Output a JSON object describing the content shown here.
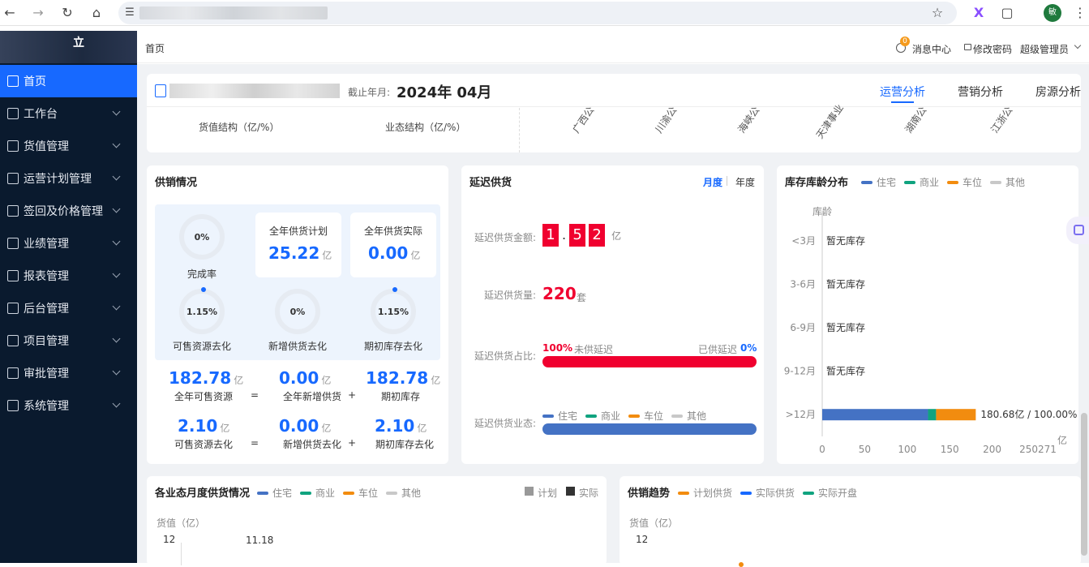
{
  "browser": {
    "profile_initial": "敏"
  },
  "sidebar": {
    "logo_char": "立",
    "items": [
      {
        "label": "首页",
        "active": true
      },
      {
        "label": "工作台"
      },
      {
        "label": "货值管理"
      },
      {
        "label": "运营计划管理"
      },
      {
        "label": "签回及价格管理"
      },
      {
        "label": "业绩管理"
      },
      {
        "label": "报表管理"
      },
      {
        "label": "后台管理"
      },
      {
        "label": "项目管理"
      },
      {
        "label": "审批管理"
      },
      {
        "label": "系统管理"
      }
    ]
  },
  "topbar": {
    "breadcrumb": "首页",
    "badge": "0",
    "messages": "消息中心",
    "change_password": "修改密码",
    "user": "超级管理员"
  },
  "header_card": {
    "deadline_label": "截止年月:",
    "deadline_value": "2024年 04月",
    "tabs": [
      "运营分析",
      "营销分析",
      "房源分析"
    ],
    "sub_labels": [
      "货值结构（亿/%）",
      "业态结构（亿/%）"
    ],
    "rotated_labels": [
      "广西公",
      "川渝公",
      "海峡公",
      "天津事业",
      "湖南公",
      "江浙公"
    ]
  },
  "supply": {
    "title": "供销情况",
    "rate_ring": "0%",
    "rate_label": "完成率",
    "plan_label": "全年供货计划",
    "plan_value": "25.22",
    "actual_label": "全年供货实际",
    "actual_value": "0.00",
    "unit": "亿",
    "rings": [
      {
        "value": "1.15%",
        "label": "可售资源去化"
      },
      {
        "value": "0%",
        "label": "新增供货去化"
      },
      {
        "value": "1.15%",
        "label": "期初库存去化"
      }
    ],
    "row1": [
      {
        "value": "182.78",
        "label": "全年可售资源"
      },
      {
        "value": "0.00",
        "label": "全年新增供货"
      },
      {
        "value": "182.78",
        "label": "期初库存"
      }
    ],
    "row2": [
      {
        "value": "2.10",
        "label": "可售资源去化"
      },
      {
        "value": "0.00",
        "label": "新增供货去化"
      },
      {
        "value": "2.10",
        "label": "期初库存去化"
      }
    ],
    "op_eq": "=",
    "op_plus": "+"
  },
  "delay": {
    "title": "延迟供货",
    "tab_month": "月度",
    "tab_year": "年度",
    "amount_label": "延迟供货金额:",
    "digits": [
      "1",
      "5",
      "2"
    ],
    "dot": ".",
    "amount_unit": "亿",
    "qty_label": "延迟供货量:",
    "qty_value": "220",
    "qty_unit": "套",
    "ratio_label": "延迟供货占比:",
    "ratio_left_pct": "100%",
    "ratio_left_text": "未供延迟",
    "ratio_right_text": "已供延迟",
    "ratio_right_pct": "0%",
    "format_label": "延迟供货业态:",
    "unsupplied_fraction": 1.0,
    "residential_fraction": 1.0
  },
  "legend": {
    "residential": "住宅",
    "commercial": "商业",
    "parking": "车位",
    "other": "其他"
  },
  "colors": {
    "residential": "#4472c4",
    "commercial": "#10a37f",
    "parking": "#f28c0f",
    "other": "#c8c8c8",
    "accent": "#1769ff",
    "red": "#f0002f"
  },
  "inventory": {
    "title": "库存库龄分布",
    "ylabel": "库龄",
    "xunit": "亿",
    "no_stock": "暂无库存",
    "bar_label": "180.68亿 / 100.00%"
  },
  "chart_data": {
    "type": "bar",
    "orientation": "horizontal",
    "stacked": true,
    "categories": [
      "<3月",
      "3-6月",
      "6-9月",
      "9-12月",
      ">12月"
    ],
    "series": [
      {
        "name": "住宅",
        "values": [
          0,
          0,
          0,
          0,
          124.5
        ]
      },
      {
        "name": "商业",
        "values": [
          0,
          0,
          0,
          0,
          9.5
        ]
      },
      {
        "name": "车位",
        "values": [
          0,
          0,
          0,
          0,
          46.68
        ]
      },
      {
        "name": "其他",
        "values": [
          0,
          0,
          0,
          0,
          0
        ]
      }
    ],
    "x_ticks": [
      "0",
      "50",
      "100",
      "150",
      "200",
      "250271"
    ],
    "xlim": [
      0,
      271
    ]
  },
  "monthly": {
    "title": "各业态月度供货情况",
    "plan": "计划",
    "actual": "实际",
    "ylabel": "货值（亿）",
    "ytick": "12",
    "value_label": "11.18"
  },
  "trend": {
    "title": "供销趋势",
    "legend": [
      "计划供货",
      "实际供货",
      "实际开盘"
    ],
    "ylabel": "货值（亿）",
    "ytick": "12"
  }
}
